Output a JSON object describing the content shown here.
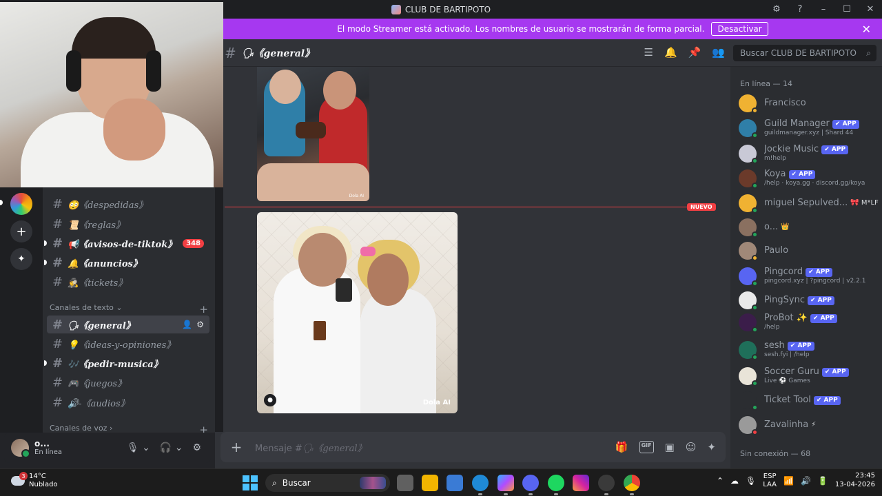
{
  "window": {
    "title": "CLUB DE BARTIPOTO",
    "controls": [
      "⚙",
      "?",
      "–",
      "☐",
      "✕"
    ]
  },
  "banner": {
    "text": "El modo Streamer está activado. Los nombres de usuario se mostrarán de forma parcial.",
    "button": "Desactivar",
    "close": "✕"
  },
  "sidebar": {
    "channels_top": [
      {
        "name": "😳《despedidas》",
        "state": "normal"
      },
      {
        "name": "📜《reglas》",
        "state": "normal"
      },
      {
        "name": "📢《avisos-de-tiktok》",
        "state": "unread",
        "badge": "348"
      },
      {
        "name": "🔔《anuncios》",
        "state": "unread"
      },
      {
        "name": "🕵️《tickets》",
        "state": "normal"
      }
    ],
    "category_text": "Canales de texto",
    "channels_text": [
      {
        "name": "🗣《general》",
        "state": "active"
      },
      {
        "name": "💡《ideas-y-opiniones》",
        "state": "normal"
      },
      {
        "name": "🎶《pedir-musica》",
        "state": "unread"
      },
      {
        "name": "🎮《juegos》",
        "state": "normal"
      },
      {
        "name": "🔊-《audios》",
        "state": "normal"
      }
    ],
    "category_voice": "Canales de voz"
  },
  "user": {
    "name": "o...",
    "status": "En línea"
  },
  "chat": {
    "channel": "🗣《general》",
    "search_placeholder": "Buscar CLUB DE BARTIPOTO",
    "watermark1": "Dola AI",
    "watermark2": "Dola AI",
    "new_label": "NUEVO",
    "composer_placeholder_prefix": "Mensaje #",
    "composer_placeholder_channel": "🗣《general》"
  },
  "members": {
    "online_header": "En línea — 14",
    "offline_header": "Sin conexión — 68",
    "list": [
      {
        "name": "Francisco",
        "sub": "",
        "app": false,
        "extra": "",
        "avatar": "#f0b232",
        "status": "#f0b232"
      },
      {
        "name": "Guild Manager",
        "sub": "guildmanager.xyz | Shard 44",
        "app": true,
        "extra": "",
        "avatar": "#2f7fa8",
        "status": "#23a55a"
      },
      {
        "name": "Jockie Music",
        "sub": "m!help",
        "app": true,
        "extra": "",
        "avatar": "#c9c9d6",
        "status": "#23a55a"
      },
      {
        "name": "Koya",
        "sub": "/help · koya.gg · discord.gg/koya",
        "app": true,
        "extra": "",
        "avatar": "#6b3a2a",
        "status": "#23a55a"
      },
      {
        "name": "miguel Sepulved...",
        "sub": "",
        "app": false,
        "extra": "🎀 M*LF",
        "avatar": "#f0b232",
        "status": "#23a55a"
      },
      {
        "name": "o...",
        "sub": "",
        "app": false,
        "extra": "👑",
        "avatar": "#8a7060",
        "status": "#23a55a"
      },
      {
        "name": "Paulo",
        "sub": "",
        "app": false,
        "extra": "",
        "avatar": "#a08878",
        "status": "#f0b232"
      },
      {
        "name": "Pingcord",
        "sub": "pingcord.xyz | ?pingcord | v2.2.1",
        "app": true,
        "extra": "",
        "avatar": "#5865f2",
        "status": "#23a55a"
      },
      {
        "name": "PingSync",
        "sub": "",
        "app": true,
        "extra": "",
        "avatar": "#eaeaea",
        "status": "#23a55a"
      },
      {
        "name": "ProBot ✨",
        "sub": "/help",
        "app": true,
        "extra": "",
        "avatar": "#3b1d4a",
        "status": "#23a55a"
      },
      {
        "name": "sesh",
        "sub": "sesh.fyi | /help",
        "app": true,
        "extra": "",
        "avatar": "#1f6f5a",
        "status": "#23a55a"
      },
      {
        "name": "Soccer Guru",
        "sub": "Live ⚽ Games",
        "app": true,
        "extra": "",
        "avatar": "#e9e4d8",
        "status": "#23a55a"
      },
      {
        "name": "Ticket Tool",
        "sub": "",
        "app": true,
        "extra": "",
        "avatar": "#2b2d31",
        "status": "#23a55a"
      },
      {
        "name": "Zavalinha",
        "sub": "",
        "app": false,
        "extra": "⚡",
        "avatar": "#9a9a9a",
        "status": "#f23f43"
      }
    ],
    "app_label": "✔ APP"
  },
  "taskbar": {
    "temp": "14°C",
    "weather": "Nublado",
    "weather_badge": "3",
    "search": "Buscar",
    "lang1": "ESP",
    "lang2": "LAA",
    "time": "23:45",
    "date": "13-04-2026"
  },
  "colors": {
    "accent": "#5865f2",
    "banner": "#a638f0",
    "danger": "#f23f43",
    "online": "#23a55a"
  }
}
